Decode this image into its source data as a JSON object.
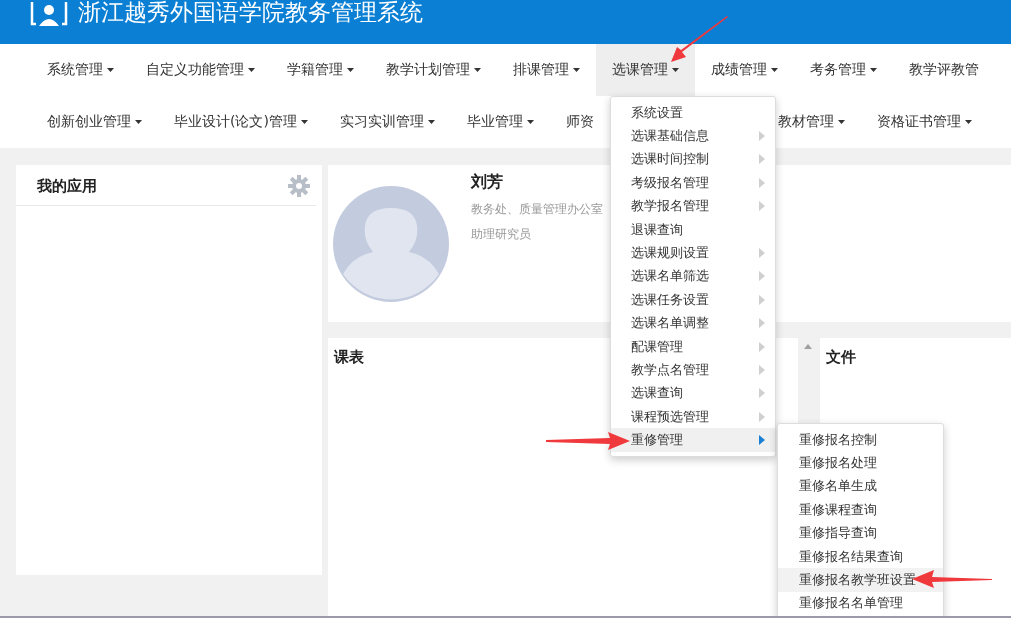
{
  "header": {
    "title": "浙江越秀外国语学院教务管理系统"
  },
  "nav_rows": [
    [
      {
        "label": "系统管理",
        "selected": false,
        "caret": true
      },
      {
        "label": "自定义功能管理",
        "selected": false,
        "caret": true
      },
      {
        "label": "学籍管理",
        "selected": false,
        "caret": true
      },
      {
        "label": "教学计划管理",
        "selected": false,
        "caret": true
      },
      {
        "label": "排课管理",
        "selected": false,
        "caret": true
      },
      {
        "label": "选课管理",
        "selected": true,
        "caret": true
      },
      {
        "label": "成绩管理",
        "selected": false,
        "caret": true
      },
      {
        "label": "考务管理",
        "selected": false,
        "caret": true
      },
      {
        "label": "教学评教管",
        "selected": false,
        "caret": false
      }
    ],
    [
      {
        "label": "创新创业管理",
        "selected": false,
        "caret": true
      },
      {
        "label": "毕业设计(论文)管理",
        "selected": false,
        "caret": true
      },
      {
        "label": "实习实训管理",
        "selected": false,
        "caret": true
      },
      {
        "label": "毕业管理",
        "selected": false,
        "caret": true
      },
      {
        "label": "师资",
        "selected": false,
        "caret": false,
        "covered": true
      },
      {
        "label": "教材管理",
        "selected": false,
        "caret": true
      },
      {
        "label": "资格证书管理",
        "selected": false,
        "caret": true
      }
    ]
  ],
  "my_apps": {
    "title": "我的应用"
  },
  "profile": {
    "name": "刘芳",
    "department": "教务处、质量管理办公室",
    "title": "助理研究员"
  },
  "schedule": {
    "title": "课表"
  },
  "files": {
    "title": "文件"
  },
  "dropdown": [
    {
      "label": "系统设置",
      "submenu": false,
      "selected": false
    },
    {
      "label": "选课基础信息",
      "submenu": true,
      "selected": false
    },
    {
      "label": "选课时间控制",
      "submenu": true,
      "selected": false
    },
    {
      "label": "考级报名管理",
      "submenu": true,
      "selected": false
    },
    {
      "label": "教学报名管理",
      "submenu": true,
      "selected": false
    },
    {
      "label": "退课查询",
      "submenu": false,
      "selected": false
    },
    {
      "label": "选课规则设置",
      "submenu": true,
      "selected": false
    },
    {
      "label": "选课名单筛选",
      "submenu": true,
      "selected": false
    },
    {
      "label": "选课任务设置",
      "submenu": true,
      "selected": false
    },
    {
      "label": "选课名单调整",
      "submenu": true,
      "selected": false
    },
    {
      "label": "配课管理",
      "submenu": true,
      "selected": false
    },
    {
      "label": "教学点名管理",
      "submenu": true,
      "selected": false
    },
    {
      "label": "选课查询",
      "submenu": true,
      "selected": false
    },
    {
      "label": "课程预选管理",
      "submenu": true,
      "selected": false
    },
    {
      "label": "重修管理",
      "submenu": true,
      "selected": true
    }
  ],
  "submenu": [
    {
      "label": "重修报名控制",
      "selected": false
    },
    {
      "label": "重修报名处理",
      "selected": false
    },
    {
      "label": "重修名单生成",
      "selected": false
    },
    {
      "label": "重修课程查询",
      "selected": false
    },
    {
      "label": "重修指导查询",
      "selected": false
    },
    {
      "label": "重修报名结果查询",
      "selected": false
    },
    {
      "label": "重修报名教学班设置",
      "selected": true
    },
    {
      "label": "重修报名名单管理",
      "selected": false
    }
  ]
}
